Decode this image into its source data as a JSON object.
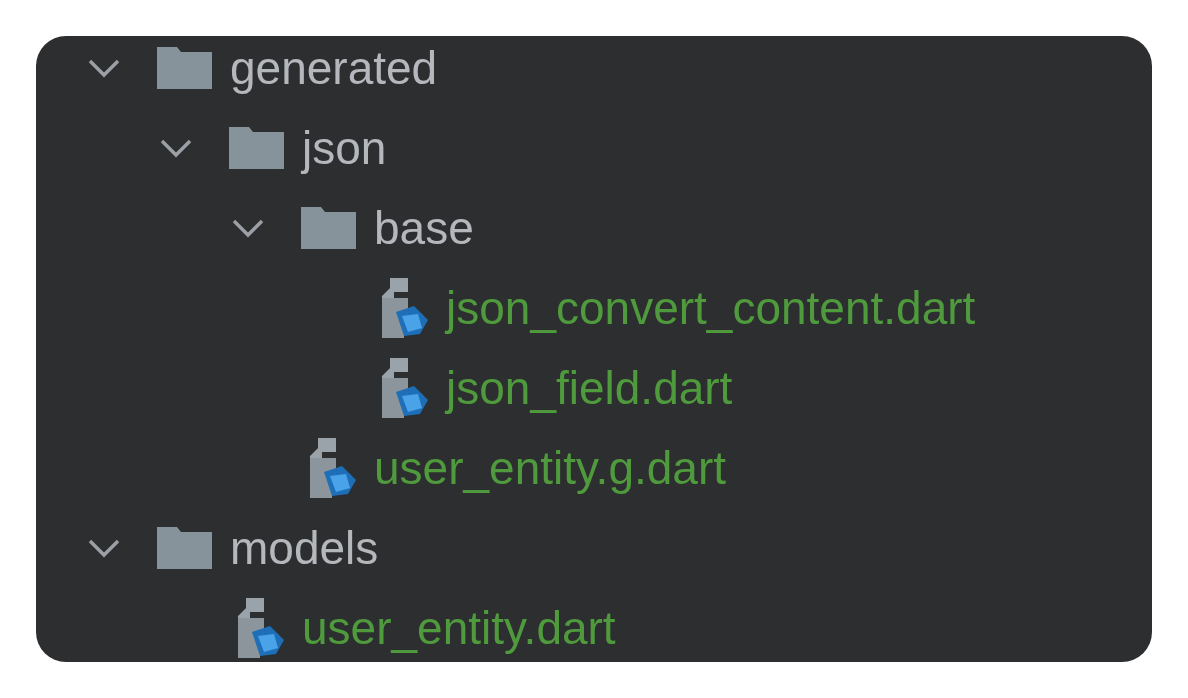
{
  "tree": [
    {
      "kind": "folder",
      "name": "generated",
      "expanded": true,
      "children": [
        {
          "kind": "folder",
          "name": "json",
          "expanded": true,
          "children": [
            {
              "kind": "folder",
              "name": "base",
              "expanded": true,
              "children": [
                {
                  "kind": "file",
                  "name": "json_convert_content.dart"
                },
                {
                  "kind": "file",
                  "name": "json_field.dart"
                }
              ]
            },
            {
              "kind": "file",
              "name": "user_entity.g.dart"
            }
          ]
        }
      ]
    },
    {
      "kind": "folder",
      "name": "models",
      "expanded": true,
      "children": [
        {
          "kind": "file",
          "name": "user_entity.dart"
        }
      ]
    }
  ]
}
